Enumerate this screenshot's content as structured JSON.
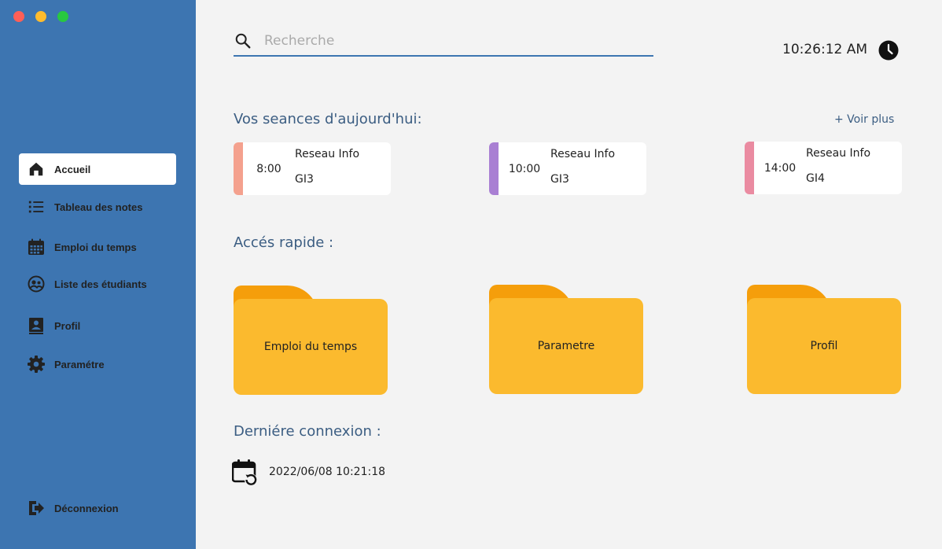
{
  "window": {
    "controls": [
      {
        "name": "close",
        "color": "#ff5f57"
      },
      {
        "name": "minimize",
        "color": "#febc2e"
      },
      {
        "name": "maximize",
        "color": "#28c840"
      }
    ]
  },
  "colors": {
    "sidebar": "#3d75b1",
    "background": "#f3f3f3",
    "title": "#3b5d82",
    "folder_tab": "#f59e0b",
    "folder_body": "#fbba2e"
  },
  "sidebar": {
    "items": [
      {
        "label": "Accueil",
        "icon": "home-icon",
        "active": true
      },
      {
        "label": "Tableau des notes",
        "icon": "list-icon",
        "active": false
      },
      {
        "label": "Emploi du temps",
        "icon": "calendar-icon",
        "active": false
      },
      {
        "label": "Liste des étudiants",
        "icon": "students-icon",
        "active": false
      },
      {
        "label": "Profil",
        "icon": "profile-icon",
        "active": false
      },
      {
        "label": "Paramétre",
        "icon": "gear-icon",
        "active": false
      }
    ],
    "logout_label": "Déconnexion"
  },
  "search": {
    "placeholder": "Recherche",
    "value": ""
  },
  "clock": {
    "time": "10:26:12 AM"
  },
  "sessions": {
    "title": "Vos seances d'aujourd'hui:",
    "more_label": "+ Voir plus",
    "items": [
      {
        "time": "8:00",
        "course": "Reseau Info",
        "group": "GI3",
        "color": "#f4a18e"
      },
      {
        "time": "10:00",
        "course": "Reseau Info",
        "group": "GI3",
        "color": "#a97fd3"
      },
      {
        "time": "14:00",
        "course": "Reseau Info",
        "group": "GI4",
        "color": "#ea8ba1"
      }
    ]
  },
  "quick_access": {
    "title": "Accés rapide :",
    "items": [
      {
        "label": "Emploi du temps"
      },
      {
        "label": "Parametre"
      },
      {
        "label": "Profil"
      }
    ]
  },
  "last_login": {
    "title": "Derniére connexion :",
    "value": "2022/06/08 10:21:18"
  }
}
